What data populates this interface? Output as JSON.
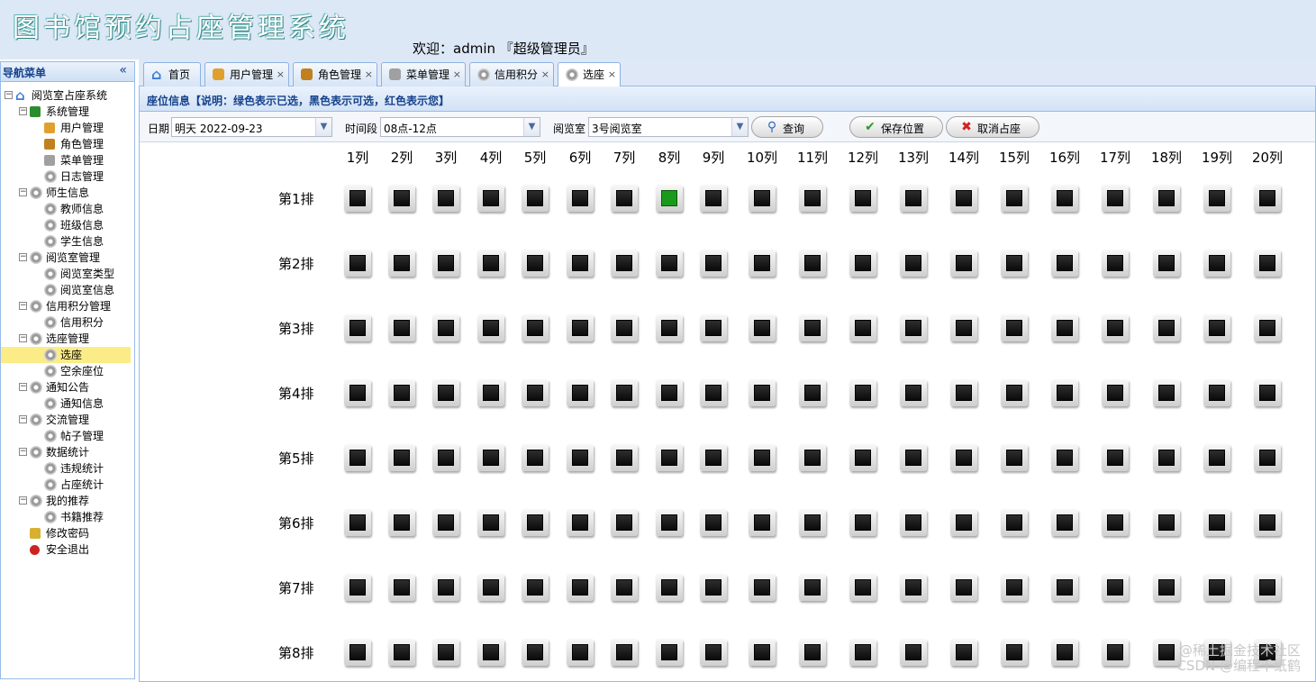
{
  "header": {
    "app_title": "图书馆预约占座管理系统",
    "welcome": "欢迎：admin 『超级管理员』"
  },
  "sidebar": {
    "title": "导航菜单",
    "collapse_icon": "double-left-chevron-icon",
    "tree": [
      {
        "label": "阅览室占座系统",
        "level": 0,
        "icon": "home-icon",
        "toggle": "−"
      },
      {
        "label": "系统管理",
        "level": 1,
        "icon": "system-icon",
        "toggle": "−"
      },
      {
        "label": "用户管理",
        "level": 2,
        "icon": "user-icon"
      },
      {
        "label": "角色管理",
        "level": 2,
        "icon": "role-icon"
      },
      {
        "label": "菜单管理",
        "level": 2,
        "icon": "menu-icon"
      },
      {
        "label": "日志管理",
        "level": 2,
        "icon": "gear-icon"
      },
      {
        "label": "师生信息",
        "level": 1,
        "icon": "gear-icon",
        "toggle": "−"
      },
      {
        "label": "教师信息",
        "level": 2,
        "icon": "gear-icon"
      },
      {
        "label": "班级信息",
        "level": 2,
        "icon": "gear-icon"
      },
      {
        "label": "学生信息",
        "level": 2,
        "icon": "gear-icon"
      },
      {
        "label": "阅览室管理",
        "level": 1,
        "icon": "gear-icon",
        "toggle": "−"
      },
      {
        "label": "阅览室类型",
        "level": 2,
        "icon": "gear-icon"
      },
      {
        "label": "阅览室信息",
        "level": 2,
        "icon": "gear-icon"
      },
      {
        "label": "信用积分管理",
        "level": 1,
        "icon": "gear-icon",
        "toggle": "−"
      },
      {
        "label": "信用积分",
        "level": 2,
        "icon": "gear-icon"
      },
      {
        "label": "选座管理",
        "level": 1,
        "icon": "gear-icon",
        "toggle": "−"
      },
      {
        "label": "选座",
        "level": 2,
        "icon": "gear-icon",
        "selected": true
      },
      {
        "label": "空余座位",
        "level": 2,
        "icon": "gear-icon"
      },
      {
        "label": "通知公告",
        "level": 1,
        "icon": "gear-icon",
        "toggle": "−"
      },
      {
        "label": "通知信息",
        "level": 2,
        "icon": "gear-icon"
      },
      {
        "label": "交流管理",
        "level": 1,
        "icon": "gear-icon",
        "toggle": "−"
      },
      {
        "label": "帖子管理",
        "level": 2,
        "icon": "gear-icon"
      },
      {
        "label": "数据统计",
        "level": 1,
        "icon": "gear-icon",
        "toggle": "−"
      },
      {
        "label": "违规统计",
        "level": 2,
        "icon": "gear-icon"
      },
      {
        "label": "占座统计",
        "level": 2,
        "icon": "gear-icon"
      },
      {
        "label": "我的推荐",
        "level": 1,
        "icon": "gear-icon",
        "toggle": "−"
      },
      {
        "label": "书籍推荐",
        "level": 2,
        "icon": "gear-icon"
      },
      {
        "label": "修改密码",
        "level": 1,
        "icon": "password-icon"
      },
      {
        "label": "安全退出",
        "level": 1,
        "icon": "exit-icon"
      }
    ]
  },
  "tabs": [
    {
      "label": "首页",
      "icon": "home-icon",
      "closable": false
    },
    {
      "label": "用户管理",
      "icon": "user-icon",
      "closable": true
    },
    {
      "label": "角色管理",
      "icon": "role-icon",
      "closable": true
    },
    {
      "label": "菜单管理",
      "icon": "menu-icon",
      "closable": true
    },
    {
      "label": "信用积分",
      "icon": "gear-icon",
      "closable": true
    },
    {
      "label": "选座",
      "icon": "gear-icon",
      "closable": true,
      "active": true
    }
  ],
  "tab_close_glyph": "×",
  "panel": {
    "title": "座位信息【说明：绿色表示已选，黑色表示可选，红色表示您】"
  },
  "toolbar": {
    "date_label": "日期",
    "date_value": "明天  2022-09-23",
    "time_label": "时间段",
    "time_value": "08点-12点",
    "room_label": "阅览室",
    "room_value": "3号阅览室",
    "query_button": "查询",
    "save_button": "保存位置",
    "cancel_button": "取消占座"
  },
  "seat_grid": {
    "columns": [
      "1列",
      "2列",
      "3列",
      "4列",
      "5列",
      "6列",
      "7列",
      "8列",
      "9列",
      "10列",
      "11列",
      "12列",
      "13列",
      "14列",
      "15列",
      "16列",
      "17列",
      "18列",
      "19列",
      "20列"
    ],
    "rows": [
      "第1排",
      "第2排",
      "第3排",
      "第4排",
      "第5排",
      "第6排",
      "第7排",
      "第8排"
    ],
    "taken_seats": [
      {
        "row": 1,
        "col": 8
      }
    ],
    "colors": {
      "available": "#1a1a1a",
      "taken": "#1a9a1a",
      "mine": "#d02020"
    }
  },
  "watermark": [
    "@稀土掘金技术社区",
    "CSDN @编程千纸鹤"
  ]
}
